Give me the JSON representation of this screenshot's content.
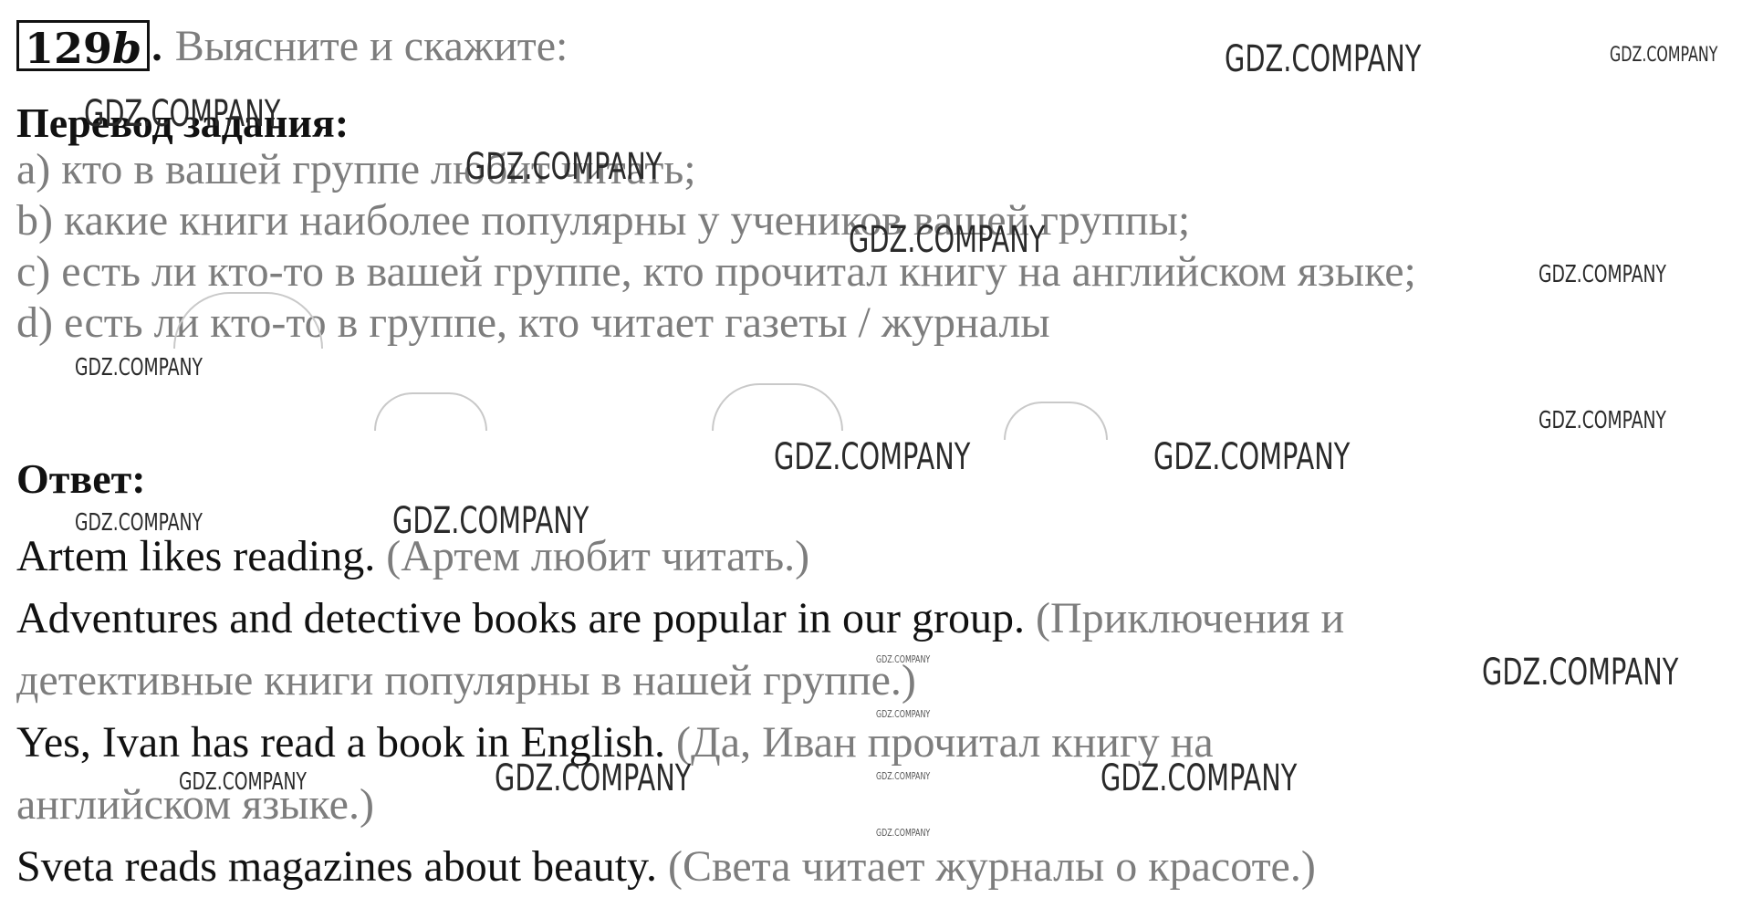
{
  "exercise": {
    "number": "129",
    "letter": "b",
    "dot": ".",
    "instruction": "Выясните и скажите:"
  },
  "task": {
    "heading": "Перевод задания:",
    "items": [
      "a) кто в вашей группе любит читать;",
      "b) какие книги наиболее популярны у учеников вашей группы;",
      "c) есть ли кто-то в вашей группе, кто прочитал книгу на английском языке;",
      "d) есть ли кто-то в группе, кто читает газеты / журналы"
    ]
  },
  "answer": {
    "heading": "Ответ:",
    "lines": [
      {
        "en": "Artem likes reading.",
        "ru": " (Артем любит читать.)"
      },
      {
        "en": "Adventures and detective books are popular in our group.",
        "ru": " (Приключения и"
      },
      {
        "en": "",
        "ru": "детективные книги популярны в нашей группе.)"
      },
      {
        "en": "Yes, Ivan has read a book in English.",
        "ru": " (Да, Иван прочитал книгу на"
      },
      {
        "en": "",
        "ru": "английском языке.)"
      },
      {
        "en": "Sveta reads magazines about beauty.",
        "ru": " (Света читает журналы о красоте.)"
      }
    ]
  },
  "watermark": {
    "text": "GDZ.COMPANY"
  }
}
